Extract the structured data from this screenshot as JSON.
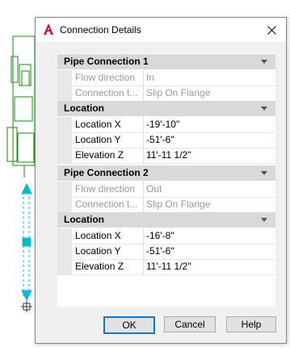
{
  "dialog": {
    "title": "Connection Details",
    "app_icon": "autocad-a-icon",
    "close_icon": "close-icon"
  },
  "properties": {
    "pipe1": {
      "header": "Pipe Connection 1",
      "flow_direction_label": "Flow direction",
      "flow_direction_value": "In",
      "connection_type_label": "Connection t...",
      "connection_type_value": "Slip On Flange",
      "location_header": "Location",
      "location_x_label": "Location X",
      "location_x_value": "-19'-10\"",
      "location_y_label": "Location Y",
      "location_y_value": "-51'-6\"",
      "elevation_z_label": "Elevation Z",
      "elevation_z_value": "11'-11 1/2\""
    },
    "pipe2": {
      "header": "Pipe Connection 2",
      "flow_direction_label": "Flow direction",
      "flow_direction_value": "Out",
      "connection_type_label": "Connection t...",
      "connection_type_value": "Slip On Flange",
      "location_header": "Location",
      "location_x_label": "Location X",
      "location_x_value": "-16'-8\"",
      "location_y_label": "Location Y",
      "location_y_value": "-51'-6\"",
      "elevation_z_label": "Elevation Z",
      "elevation_z_value": "11'-11 1/2\""
    }
  },
  "buttons": {
    "ok": "OK",
    "cancel": "Cancel",
    "help": "Help"
  },
  "colors": {
    "cad_green": "#1a8a1a",
    "cad_cyan": "#00bcd4",
    "accent": "#0078d7",
    "autocad_red": "#c8102e"
  }
}
